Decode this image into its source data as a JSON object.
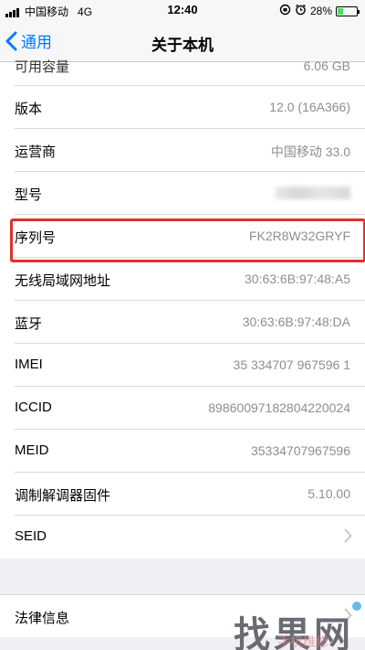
{
  "status_bar": {
    "carrier": "中国移动",
    "network": "4G",
    "time": "12:40",
    "battery": "28%",
    "battery_level": 0.28
  },
  "nav": {
    "back_label": "通用",
    "title": "关于本机"
  },
  "rows": [
    {
      "label": "可用容量",
      "value": "6.06 GB"
    },
    {
      "label": "版本",
      "value": "12.0 (16A366)"
    },
    {
      "label": "运营商",
      "value": "中国移动 33.0"
    },
    {
      "label": "型号",
      "value": ""
    },
    {
      "label": "序列号",
      "value": "FK2R8W32GRYF"
    },
    {
      "label": "无线局域网地址",
      "value": "30:63:6B:97:48:A5"
    },
    {
      "label": "蓝牙",
      "value": "30:63:6B:97:48:DA"
    },
    {
      "label": "IMEI",
      "value": "35 334707 967596 1"
    },
    {
      "label": "ICCID",
      "value": "89860097182804220024"
    },
    {
      "label": "MEID",
      "value": "35334707967596"
    },
    {
      "label": "调制解调器固件",
      "value": "5.10.00"
    },
    {
      "label": "SEID",
      "value": ""
    }
  ],
  "legal": {
    "label": "法律信息"
  },
  "watermark": {
    "main": "找果网",
    "sub": "手机维修"
  },
  "colors": {
    "accent": "#007aff",
    "highlight": "#e0302d",
    "value_text": "#8e8e93"
  }
}
